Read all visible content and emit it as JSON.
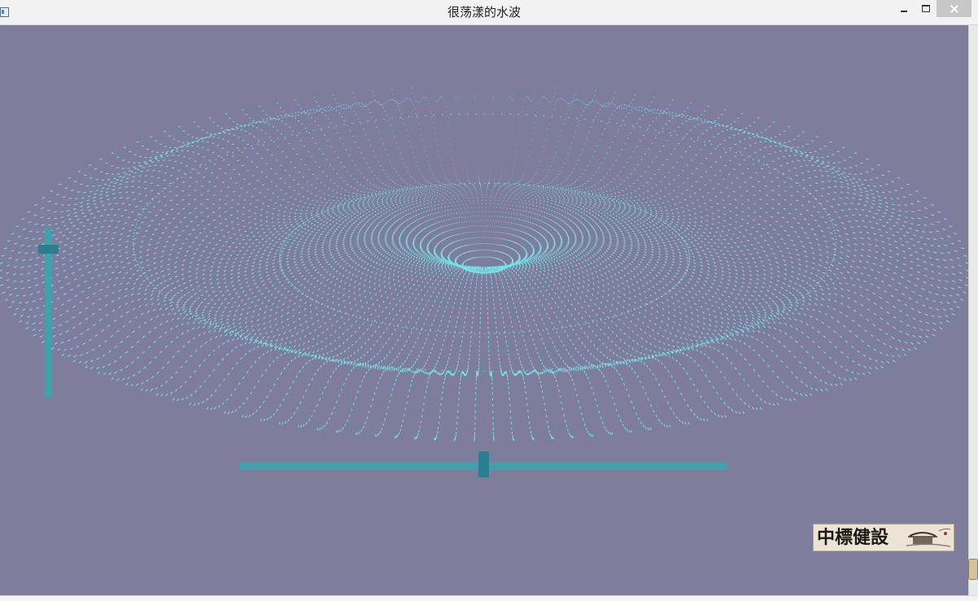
{
  "window": {
    "title": "很荡漾的水波",
    "title_icon": "app-window-icon",
    "controls": {
      "minimize_icon": "minimize-icon",
      "maximize_icon": "maximize-icon",
      "close_icon": "close-icon"
    }
  },
  "canvas": {
    "background": "#7e7e9c",
    "wave_color": "#74eef0",
    "slider_track_color": "#3aa4ad",
    "slider_knob_color": "#2b7e90"
  },
  "sliders": {
    "vertical": {
      "value_fraction": 0.9
    },
    "horizontal": {
      "value_fraction": 0.5
    }
  },
  "logo": {
    "text": "中標健設",
    "art_icon": "pavilion-painting-icon"
  }
}
